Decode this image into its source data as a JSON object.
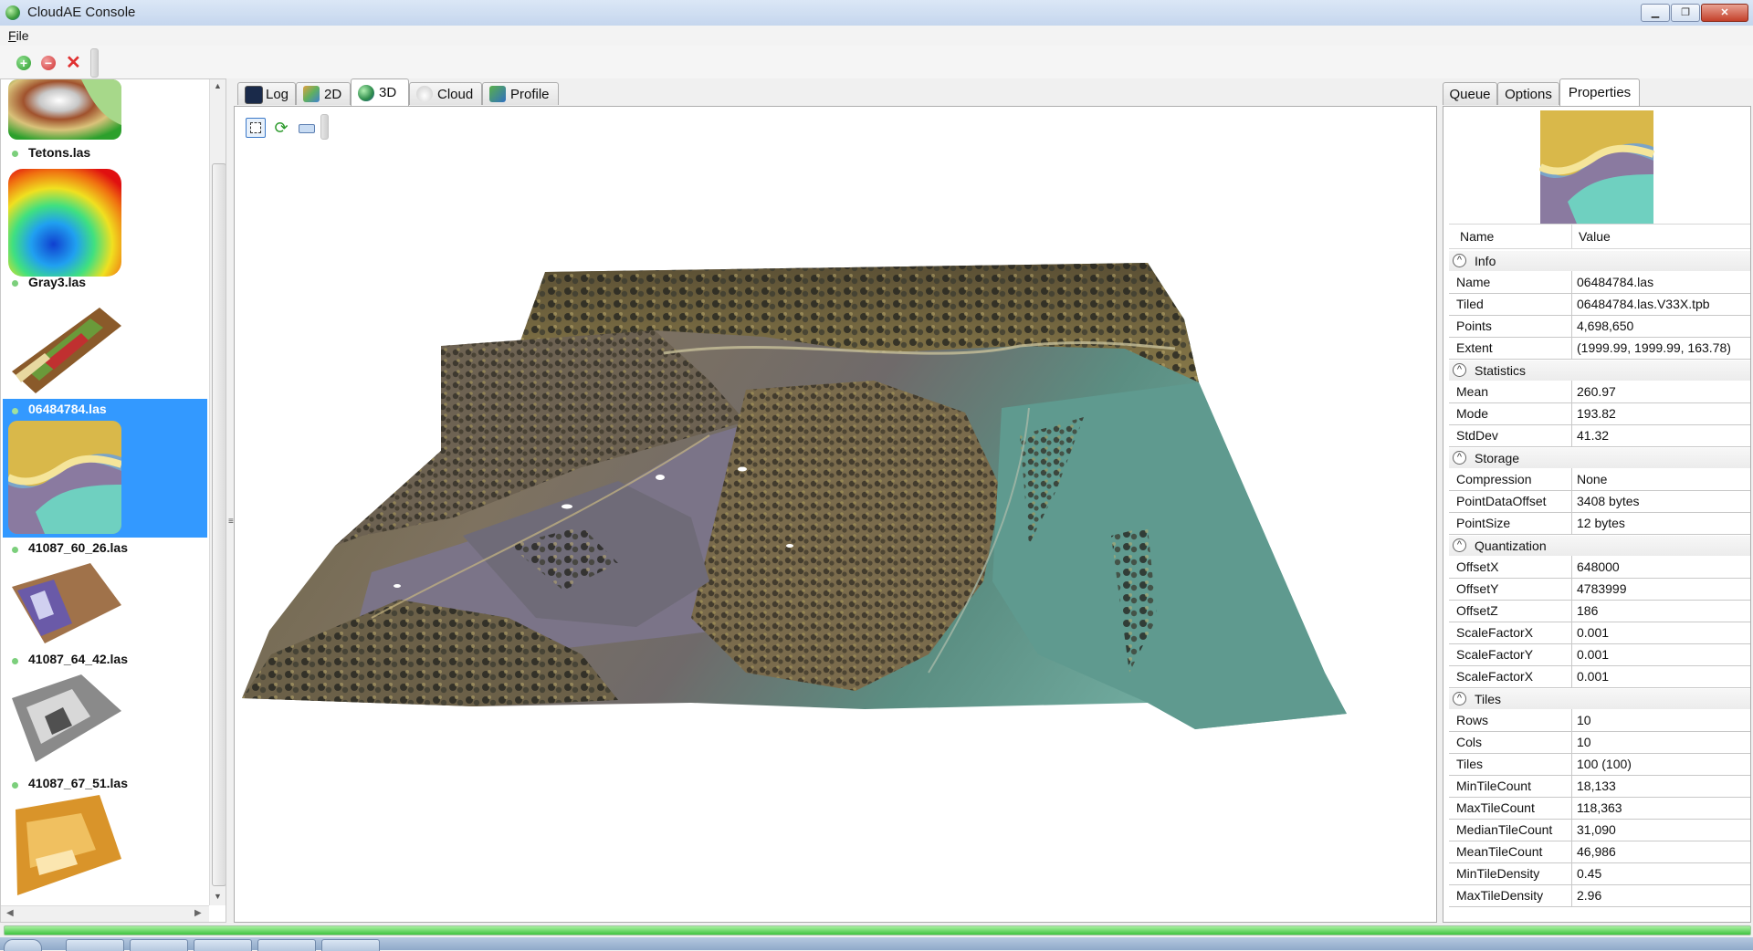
{
  "window": {
    "title": "CloudAE Console",
    "controls": {
      "minimize": "▁",
      "maximize": "❐",
      "close": "✕"
    }
  },
  "menu": {
    "file_prefix": "F",
    "file_rest": "ile"
  },
  "toolbar": {
    "icons": [
      "add-icon",
      "remove-icon",
      "delete-icon"
    ]
  },
  "files": [
    {
      "label": "Tetons.las",
      "thumb": "tetons-elevation"
    },
    {
      "label": "Gray3.las",
      "thumb": "gray3-rainbow"
    },
    {
      "label": "",
      "thumb": "colored-strip"
    },
    {
      "label": "06484784.las",
      "thumb": "06484784-elevation",
      "selected": true
    },
    {
      "label": "41087_60_26.las",
      "thumb": "purple-brown-tile"
    },
    {
      "label": "41087_64_42.las",
      "thumb": "gray-tile"
    },
    {
      "label": "41087_67_51.las",
      "thumb": "orange-tile"
    }
  ],
  "center_tabs": [
    {
      "label": "Log",
      "icon": "console-icon"
    },
    {
      "label": "2D",
      "icon": "map-2d-icon"
    },
    {
      "label": "3D",
      "icon": "globe-icon",
      "active": true
    },
    {
      "label": "Cloud",
      "icon": "cloud-icon"
    },
    {
      "label": "Profile",
      "icon": "profile-icon"
    }
  ],
  "view_toolbar": {
    "icons": [
      "select-region-icon",
      "refresh-icon",
      "keyboard-icon"
    ]
  },
  "right_tabs": [
    {
      "label": "Queue"
    },
    {
      "label": "Options"
    },
    {
      "label": "Properties",
      "active": true
    }
  ],
  "properties": {
    "header": {
      "name": "Name",
      "value": "Value"
    },
    "groups": [
      {
        "label": "Info",
        "rows": [
          {
            "name": "Name",
            "value": "06484784.las"
          },
          {
            "name": "Tiled",
            "value": "06484784.las.V33X.tpb"
          },
          {
            "name": "Points",
            "value": "4,698,650"
          },
          {
            "name": "Extent",
            "value": "(1999.99, 1999.99, 163.78)"
          }
        ]
      },
      {
        "label": "Statistics",
        "rows": [
          {
            "name": "Mean",
            "value": "260.97"
          },
          {
            "name": "Mode",
            "value": "193.82"
          },
          {
            "name": "StdDev",
            "value": "41.32"
          }
        ]
      },
      {
        "label": "Storage",
        "rows": [
          {
            "name": "Compression",
            "value": "None"
          },
          {
            "name": "PointDataOffset",
            "value": "3408 bytes"
          },
          {
            "name": "PointSize",
            "value": "12 bytes"
          }
        ]
      },
      {
        "label": "Quantization",
        "rows": [
          {
            "name": "OffsetX",
            "value": "648000"
          },
          {
            "name": "OffsetY",
            "value": "4783999"
          },
          {
            "name": "OffsetZ",
            "value": "186"
          },
          {
            "name": "ScaleFactorX",
            "value": "0.001"
          },
          {
            "name": "ScaleFactorY",
            "value": "0.001"
          },
          {
            "name": "ScaleFactorX",
            "value": "0.001"
          }
        ]
      },
      {
        "label": "Tiles",
        "rows": [
          {
            "name": "Rows",
            "value": "10"
          },
          {
            "name": "Cols",
            "value": "10"
          },
          {
            "name": "Tiles",
            "value": "100 (100)"
          },
          {
            "name": "MinTileCount",
            "value": "18,133"
          },
          {
            "name": "MaxTileCount",
            "value": "118,363"
          },
          {
            "name": "MedianTileCount",
            "value": "31,090"
          },
          {
            "name": "MeanTileCount",
            "value": "46,986"
          },
          {
            "name": "MinTileDensity",
            "value": "0.45"
          },
          {
            "name": "MaxTileDensity",
            "value": "2.96"
          }
        ]
      }
    ]
  },
  "status": {
    "progress": 1.0
  },
  "colors": {
    "selection": "#3399ff",
    "progress": "#40c440",
    "terrain_low": "#5fa89a",
    "terrain_high": "#8a7a3c"
  }
}
